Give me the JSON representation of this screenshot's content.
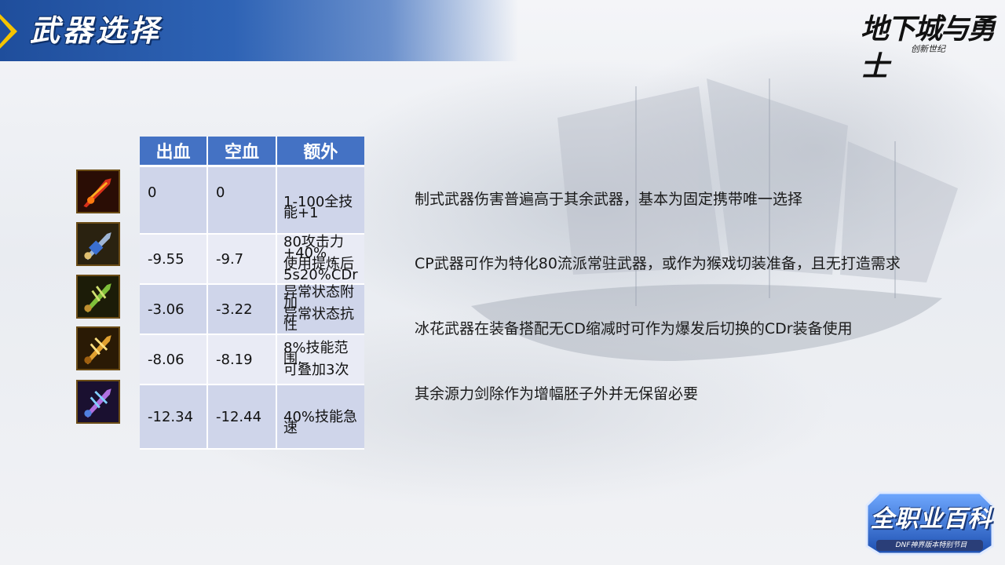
{
  "header": {
    "title": "武器选择"
  },
  "logo": {
    "main": "地下城与勇士",
    "sub": "创新世纪"
  },
  "table": {
    "columns": [
      "出血",
      "空血",
      "额外"
    ],
    "rows": [
      {
        "icon": "flame-sword-icon",
        "bleed": "0",
        "empty": "0",
        "extra": "1-100全技能+1"
      },
      {
        "icon": "mech-sword-icon",
        "bleed": "-9.55",
        "empty": "-9.7",
        "extra": "80攻击力+40%\n使用提炼后\n5s20%CDr"
      },
      {
        "icon": "green-sword-icon",
        "bleed": "-3.06",
        "empty": "-3.22",
        "extra": "异常状态附加\n异常状态抗性"
      },
      {
        "icon": "gold-sword-icon",
        "bleed": "-8.06",
        "empty": "-8.19",
        "extra": "8%技能范围,\n可叠加3次"
      },
      {
        "icon": "ice-sword-icon",
        "bleed": "-12.34",
        "empty": "-12.44",
        "extra": "40%技能急速"
      }
    ]
  },
  "notes": [
    "制式武器伤害普遍高于其余武器，基本为固定携带唯一选择",
    "CP武器可作为特化80流派常驻武器，或作为猴戏切装准备，且无打造需求",
    "冰花武器在装备搭配无CD缩减时可作为爆发后切换的CDr装备使用",
    "其余源力剑除作为增幅胚子外并无保留必要"
  ],
  "badge": {
    "title": "全职业百科",
    "sub": "DNF神界版本特别节目"
  },
  "colors": {
    "header_blue": "#2e63b5",
    "table_header": "#4472c4",
    "row_odd": "#cfd5ea",
    "row_even": "#e9ebf5"
  }
}
